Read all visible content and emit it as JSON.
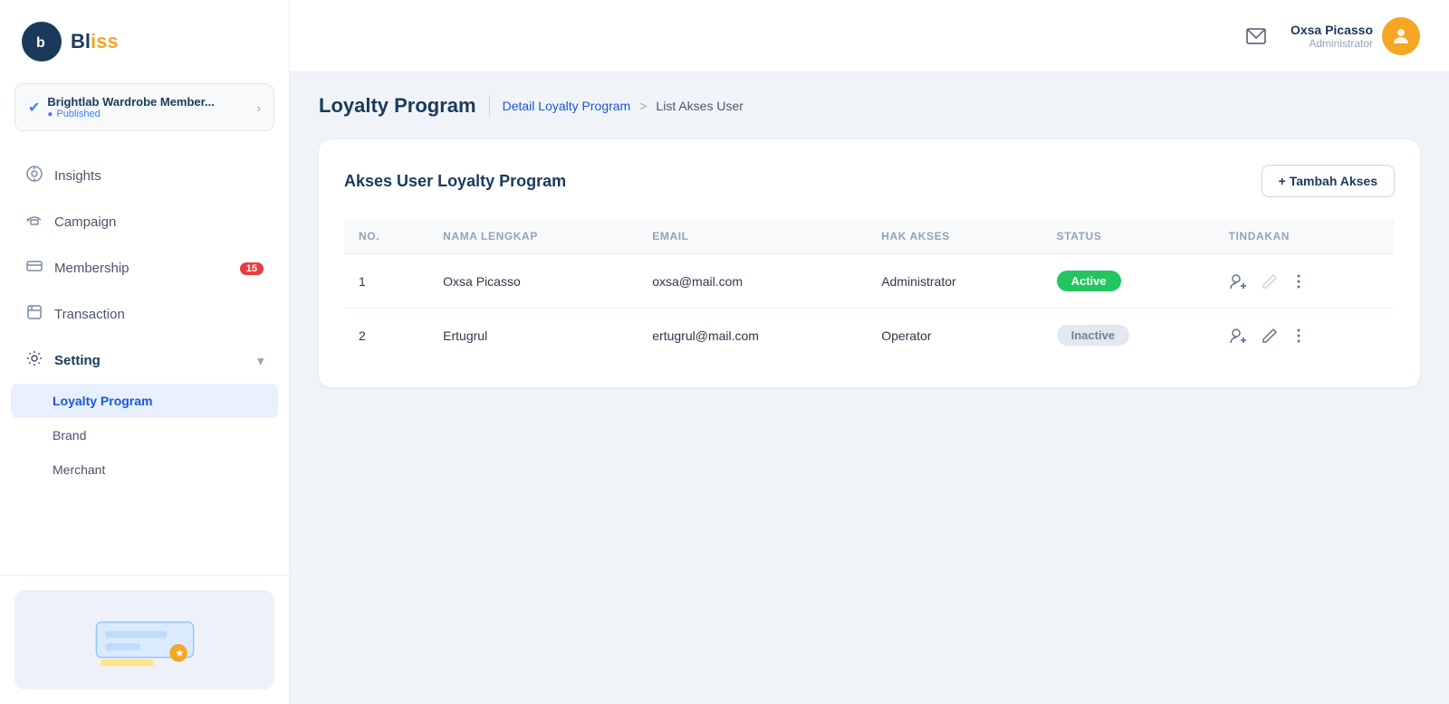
{
  "app": {
    "logo_letter": "b",
    "logo_name": "Bl",
    "logo_accent": "iss",
    "logo_underline": "___"
  },
  "workspace": {
    "name": "Brightlab Wardrobe Member...",
    "status": "Published"
  },
  "sidebar": {
    "items": [
      {
        "id": "insights",
        "label": "Insights",
        "icon": "insights"
      },
      {
        "id": "campaign",
        "label": "Campaign",
        "icon": "campaign"
      },
      {
        "id": "membership",
        "label": "Membership",
        "icon": "membership",
        "badge": "15"
      },
      {
        "id": "transaction",
        "label": "Transaction",
        "icon": "transaction"
      },
      {
        "id": "setting",
        "label": "Setting",
        "icon": "setting",
        "arrow": "▾"
      }
    ],
    "sub_items": [
      {
        "id": "loyalty-program",
        "label": "Loyalty Program",
        "active": true
      },
      {
        "id": "brand",
        "label": "Brand"
      },
      {
        "id": "merchant",
        "label": "Merchant"
      }
    ]
  },
  "header": {
    "user_name": "Oxsa Picasso",
    "user_role": "Administrator"
  },
  "breadcrumb": {
    "main": "Loyalty Program",
    "link": "Detail Loyalty Program",
    "arrow": ">",
    "current": "List Akses User"
  },
  "page": {
    "title": "Akses User Loyalty Program",
    "add_button": "+ Tambah Akses",
    "table": {
      "columns": [
        "NO.",
        "NAMA LENGKAP",
        "EMAIL",
        "HAK AKSES",
        "STATUS",
        "TINDAKAN"
      ],
      "rows": [
        {
          "no": "1",
          "nama": "Oxsa Picasso",
          "email": "oxsa@mail.com",
          "hak_akses": "Administrator",
          "status": "Active",
          "status_type": "active"
        },
        {
          "no": "2",
          "nama": "Ertugrul",
          "email": "ertugrul@mail.com",
          "hak_akses": "Operator",
          "status": "Inactive",
          "status_type": "inactive"
        }
      ]
    }
  }
}
